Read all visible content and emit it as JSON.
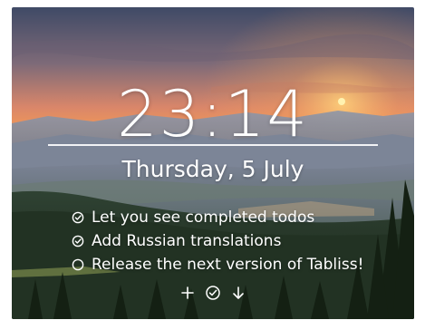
{
  "clock": {
    "time": "23:14"
  },
  "date": {
    "text": "Thursday, 5 July"
  },
  "todos": [
    {
      "label": "Let you see completed todos",
      "done": true,
      "icon": "check-circle-icon"
    },
    {
      "label": "Add Russian translations",
      "done": true,
      "icon": "check-circle-icon"
    },
    {
      "label": "Release the next version of Tabliss!",
      "done": false,
      "icon": "circle-icon"
    }
  ],
  "actions": [
    {
      "name": "add-todo-button",
      "icon": "plus-icon"
    },
    {
      "name": "show-completed-button",
      "icon": "check-circle-icon"
    },
    {
      "name": "more-todos-button",
      "icon": "arrow-down-icon"
    }
  ],
  "colors": {
    "sky_top": "#3f4b66",
    "sunset": "#f08a4b",
    "sun": "#fff2b0",
    "forest": "#1f2d1c",
    "text": "#ffffff"
  }
}
